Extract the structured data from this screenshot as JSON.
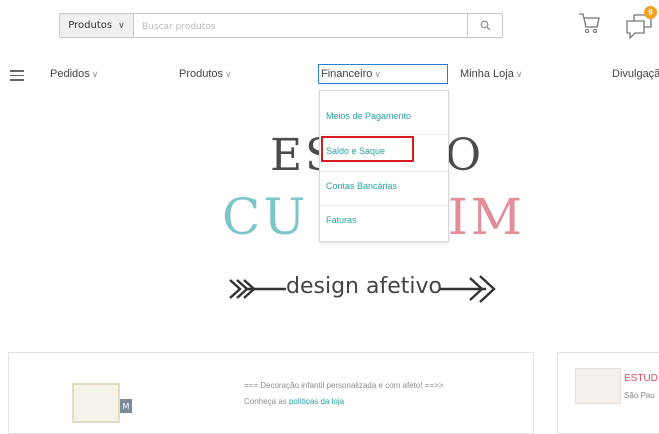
{
  "header": {
    "search_scope": "Produtos",
    "search_placeholder": "Buscar produtos",
    "notification_count": "9"
  },
  "nav": {
    "items": [
      {
        "label": "Pedidos"
      },
      {
        "label": "Produtos"
      },
      {
        "label": "Financeiro"
      },
      {
        "label": "Minha Loja"
      },
      {
        "label": "Divulgaçã"
      }
    ]
  },
  "dropdown": {
    "items": [
      {
        "label": "Meios de Pagamento"
      },
      {
        "label": "Saldo e Saque"
      },
      {
        "label": "Contas Bancárias"
      },
      {
        "label": "Faturas"
      }
    ],
    "highlighted": "Saldo e Saque"
  },
  "banner": {
    "line1_left": "ES",
    "line1_right": "O",
    "line2_left": "CU",
    "line2_right": "IM",
    "tagline": "design afetivo",
    "colors": {
      "brand_teal": "#7cc6c8",
      "brand_pink": "#e28d98",
      "dark": "#4b4b4b"
    }
  },
  "shop_card": {
    "description": "=== Decoração infantil personalizada e com afeto! ==>>",
    "policies_prefix": "Conheça as",
    "policies_link": "políticas da loja",
    "thumb_tag": "M"
  },
  "side_card": {
    "title": "ESTUD",
    "subtitle": "São Pau"
  },
  "colors": {
    "accent_link": "#2aa3a0",
    "highlight_red": "#d41c20",
    "nav_focus_blue": "#2a7fcf",
    "badge_orange": "#f0a020"
  }
}
